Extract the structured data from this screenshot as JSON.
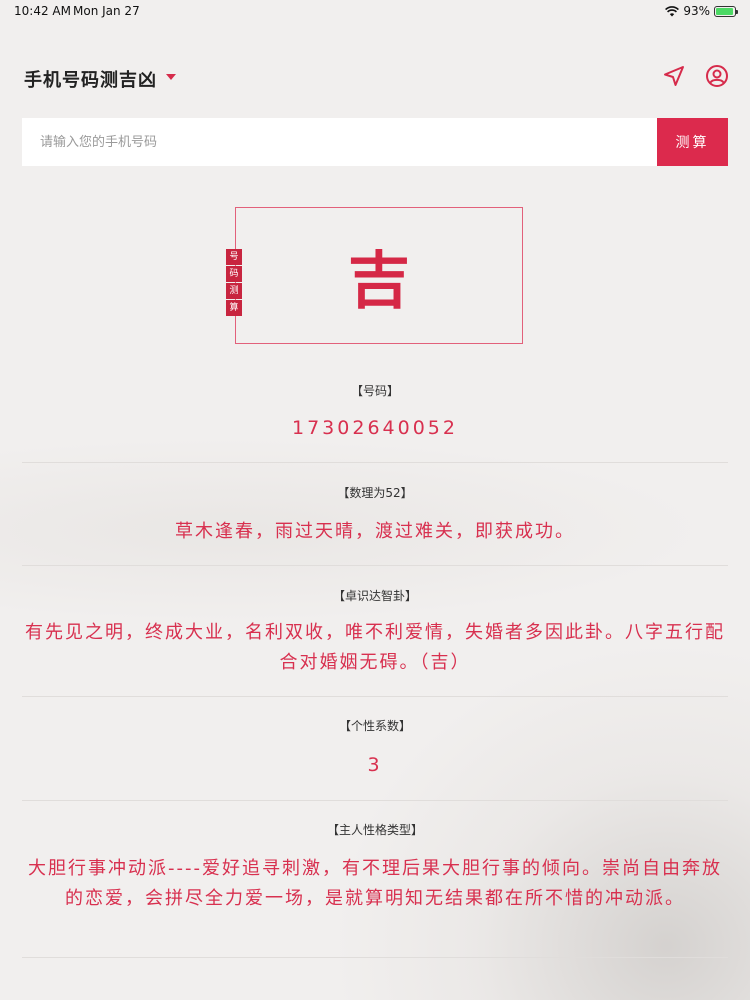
{
  "status_bar": {
    "time": "10:42 AM",
    "date": "Mon Jan 27",
    "battery": "93%",
    "battery_level": 0.93
  },
  "nav": {
    "title": "手机号码测吉凶",
    "location_icon": "location-arrow-icon",
    "user_icon": "user-circle-icon"
  },
  "search": {
    "placeholder": "请输入您的手机号码",
    "button_label": "测算"
  },
  "result": {
    "seal_chars": [
      "号",
      "码",
      "测",
      "算"
    ],
    "verdict": "吉"
  },
  "sections": [
    {
      "label": "【号码】",
      "value": "17302640052"
    },
    {
      "label": "【数理为52】",
      "value": "草木逢春，雨过天晴，渡过难关，即获成功。"
    },
    {
      "label": "【卓识达智卦】",
      "value": "有先见之明，终成大业，名利双收，唯不利爱情，失婚者多因此卦。八字五行配合对婚姻无碍。（吉）"
    },
    {
      "label": "【个性系数】",
      "value": "3"
    },
    {
      "label": "【主人性格类型】",
      "value": "大胆行事冲动派----爱好追寻刺激，有不理后果大胆行事的倾向。崇尚自由奔放的恋爱，会拼尽全力爱一场，是就算明知无结果都在所不惜的冲动派。"
    }
  ],
  "colors": {
    "accent": "#dc2a4d",
    "background": "#f1efee"
  }
}
